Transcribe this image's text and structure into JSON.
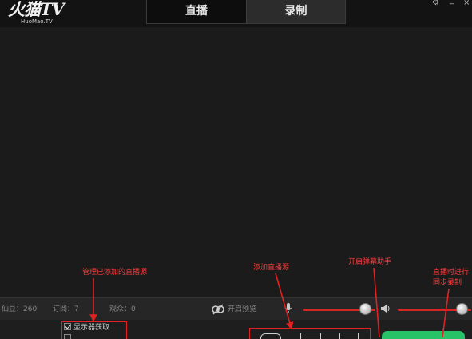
{
  "app": {
    "logo_main": "火猫TV",
    "logo_sub": "HuoMao.TV"
  },
  "tabs": [
    {
      "label": "直播",
      "active": true
    },
    {
      "label": "录制",
      "active": false
    }
  ],
  "window_controls": [
    "gear-icon",
    "minimize-icon",
    "close-icon"
  ],
  "status": {
    "fans": "仙豆：260",
    "subs": "订阅：7",
    "viewers": "观众：0",
    "preview_label": "开启预览"
  },
  "audio": {
    "mic_level": 0.93,
    "speaker_level": 0.95
  },
  "sources": [
    {
      "label": "显示器获取",
      "checked": true
    },
    {
      "label": "",
      "checked": false
    }
  ],
  "annotations": {
    "manage_sources": "管理已添加的直播源",
    "add_source": "添加直播源",
    "danmaku": "开启弹幕助手",
    "sync_record_line1": "直播时进行",
    "sync_record_line2": "同步录制"
  },
  "colors": {
    "accent_red": "#d72626",
    "annotation_red": "#ff3b3b",
    "go_live_green": "#27c267"
  }
}
